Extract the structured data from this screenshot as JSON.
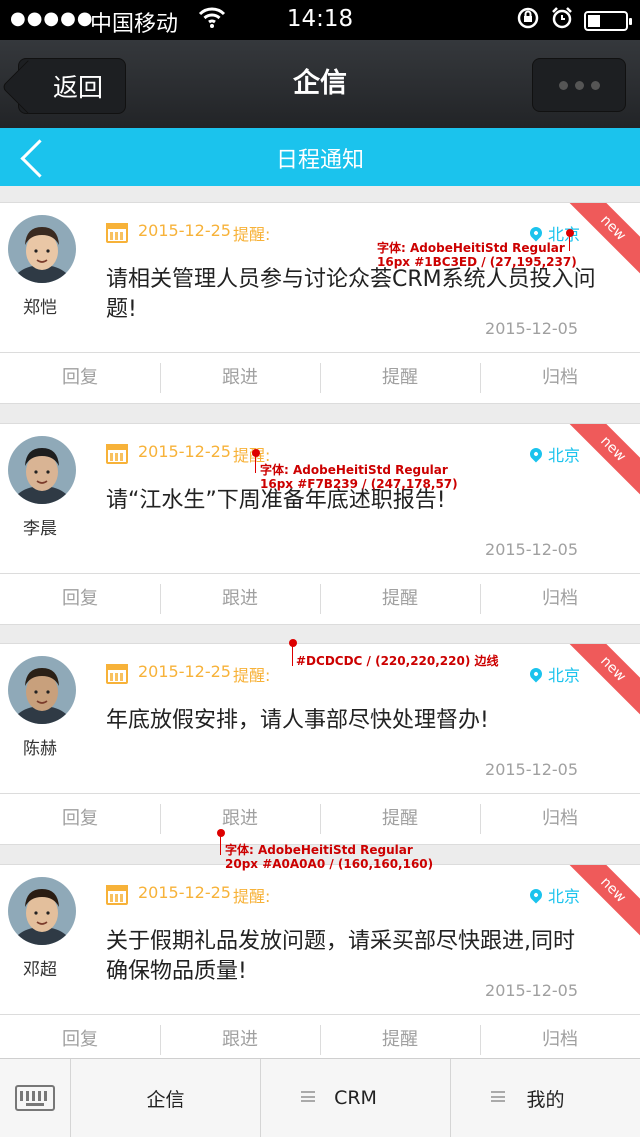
{
  "status": {
    "dots": "●●●●●",
    "carrier": "中国移动",
    "time": "14:18"
  },
  "nav": {
    "back_label": "返回",
    "title": "企信"
  },
  "subnav": {
    "title": "日程通知"
  },
  "colors": {
    "accent": "#1BC3ED",
    "orange": "#F7B239",
    "border": "#DCDCDC",
    "muted": "#A0A0A0",
    "badge": "#EF5A5A"
  },
  "cards": [
    {
      "name": "郑恺",
      "date": "2015-12-25",
      "remind": "提醒:",
      "location": "北京",
      "badge": "new",
      "message": "请相关管理人员参与讨论众荟CRM系统人员投入问题!",
      "sent": "2015-12-05",
      "actions": [
        "回复",
        "跟进",
        "提醒",
        "归档"
      ]
    },
    {
      "name": "李晨",
      "date": "2015-12-25",
      "remind": "提醒:",
      "location": "北京",
      "badge": "new",
      "message": "请“江水生”下周准备年底述职报告!",
      "sent": "2015-12-05",
      "actions": [
        "回复",
        "跟进",
        "提醒",
        "归档"
      ]
    },
    {
      "name": "陈赫",
      "date": "2015-12-25",
      "remind": "提醒:",
      "location": "北京",
      "badge": "new",
      "message": "年底放假安排，请人事部尽快处理督办!",
      "sent": "2015-12-05",
      "actions": [
        "回复",
        "跟进",
        "提醒",
        "归档"
      ]
    },
    {
      "name": "邓超",
      "date": "2015-12-25",
      "remind": "提醒:",
      "location": "北京",
      "badge": "new",
      "message": "关于假期礼品发放问题，请采买部尽快跟进,同时确保物品质量!",
      "sent": "2015-12-05",
      "actions": [
        "回复",
        "跟进",
        "提醒",
        "归档"
      ]
    }
  ],
  "annotations": [
    {
      "line1": "字体: AdobeHeitiStd Regular",
      "line2": "16px #1BC3ED / (27,195,237)"
    },
    {
      "line1": "字体: AdobeHeitiStd Regular",
      "line2": "16px #F7B239 / (247,178,57)"
    },
    {
      "line1": "#DCDCDC / (220,220,220) 边线",
      "line2": ""
    },
    {
      "line1": "字体: AdobeHeitiStd Regular",
      "line2": "20px #A0A0A0 / (160,160,160)"
    }
  ],
  "tabbar": {
    "tabs": [
      "企信",
      "CRM",
      "我的"
    ]
  }
}
